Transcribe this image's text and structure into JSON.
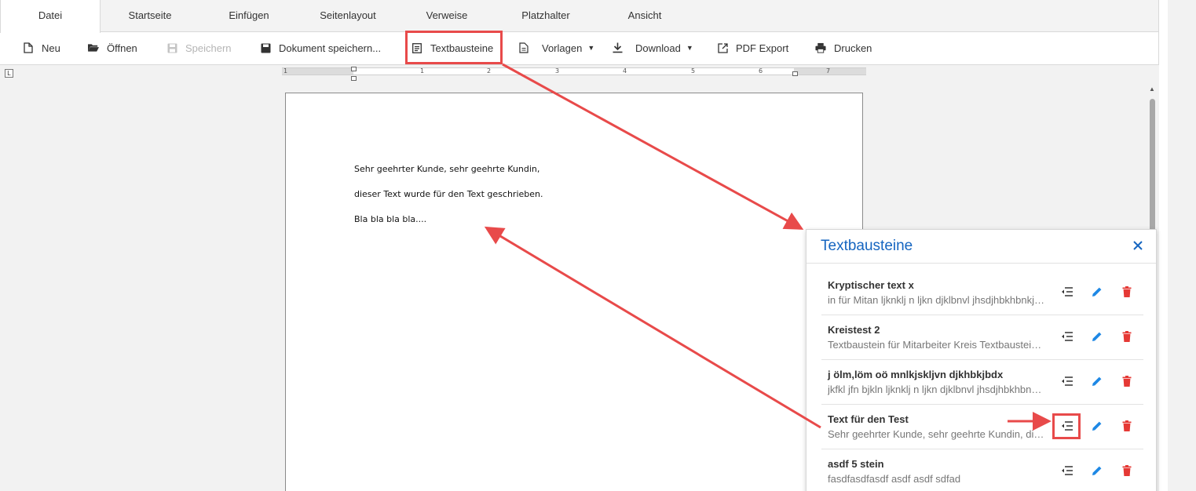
{
  "tabs": [
    {
      "label": "Datei"
    },
    {
      "label": "Startseite"
    },
    {
      "label": "Einfügen"
    },
    {
      "label": "Seitenlayout"
    },
    {
      "label": "Verweise"
    },
    {
      "label": "Platzhalter"
    },
    {
      "label": "Ansicht"
    }
  ],
  "toolbar": {
    "new_label": "Neu",
    "open_label": "Öffnen",
    "save_label": "Speichern",
    "save_document_label": "Dokument speichern...",
    "text_blocks_label": "Textbausteine",
    "templates_label": "Vorlagen",
    "download_label": "Download",
    "pdf_export_label": "PDF Export",
    "print_label": "Drucken"
  },
  "ruler": {
    "numbers": [
      "1",
      "1",
      "2",
      "3",
      "4",
      "5",
      "6",
      "7"
    ]
  },
  "document": {
    "lines": [
      "Sehr geehrter Kunde, sehr geehrte Kundin,",
      "dieser Text wurde für den Text geschrieben.",
      "Bla bla bla bla...."
    ]
  },
  "panel": {
    "title": "Textbausteine",
    "items": [
      {
        "title": "Kryptischer text x",
        "preview": "in für Mitan ljknklj n ljkn djklbnvl jhsdjhbkhbnkjhbkhbkbkbjhbkjhb"
      },
      {
        "title": "Kreistest 2",
        "preview": "Textbaustein für Mitarbeiter Kreis Textbaustein für Mitarbeiter"
      },
      {
        "title": "j ölm,löm oö mnlkjskljvn djkhbkjbdx",
        "preview": "jkfkl jfn bjkln ljknklj n ljkn djklbnvl jhsdjhbkhbnkjhbkhbkbkbjhb"
      },
      {
        "title": "Text für den Test",
        "preview": "Sehr geehrter Kunde, sehr geehrte Kundin, dieser Text wurde für"
      },
      {
        "title": "asdf 5 stein",
        "preview": "fasdfasdfasdf asdf asdf sdfad"
      }
    ]
  },
  "colors": {
    "accent": "#1565c0",
    "edit_icon": "#1e88e5",
    "delete_icon": "#e53935",
    "annotation": "#e84a4a"
  },
  "icons": {
    "insert": "insert-lines-icon",
    "edit": "pencil-icon",
    "delete": "trash-icon",
    "close": "close-icon"
  }
}
